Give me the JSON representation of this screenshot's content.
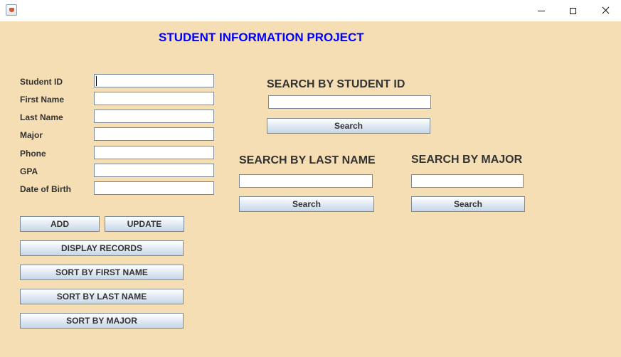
{
  "window": {
    "title": "",
    "icon": "java-icon"
  },
  "page_title": "STUDENT INFORMATION PROJECT",
  "form": {
    "fields": [
      {
        "label": "Student ID",
        "value": ""
      },
      {
        "label": "First Name",
        "value": ""
      },
      {
        "label": "Last Name",
        "value": ""
      },
      {
        "label": "Major",
        "value": ""
      },
      {
        "label": "Phone",
        "value": ""
      },
      {
        "label": "GPA",
        "value": ""
      },
      {
        "label": "Date of Birth",
        "value": ""
      }
    ]
  },
  "actions": {
    "add": "ADD",
    "update": "UPDATE",
    "display": "DISPLAY RECORDS",
    "sort_first": "SORT BY FIRST NAME",
    "sort_last": "SORT BY LAST NAME",
    "sort_major": "SORT BY MAJOR"
  },
  "search": {
    "by_id": {
      "title": "SEARCH BY STUDENT ID",
      "value": "",
      "button": "Search"
    },
    "by_last": {
      "title": "SEARCH BY LAST NAME",
      "value": "",
      "button": "Search"
    },
    "by_major": {
      "title": "SEARCH BY MAJOR",
      "value": "",
      "button": "Search"
    }
  },
  "colors": {
    "background": "#f5deb3",
    "title_text": "#0000ff",
    "label_text": "#333333"
  }
}
